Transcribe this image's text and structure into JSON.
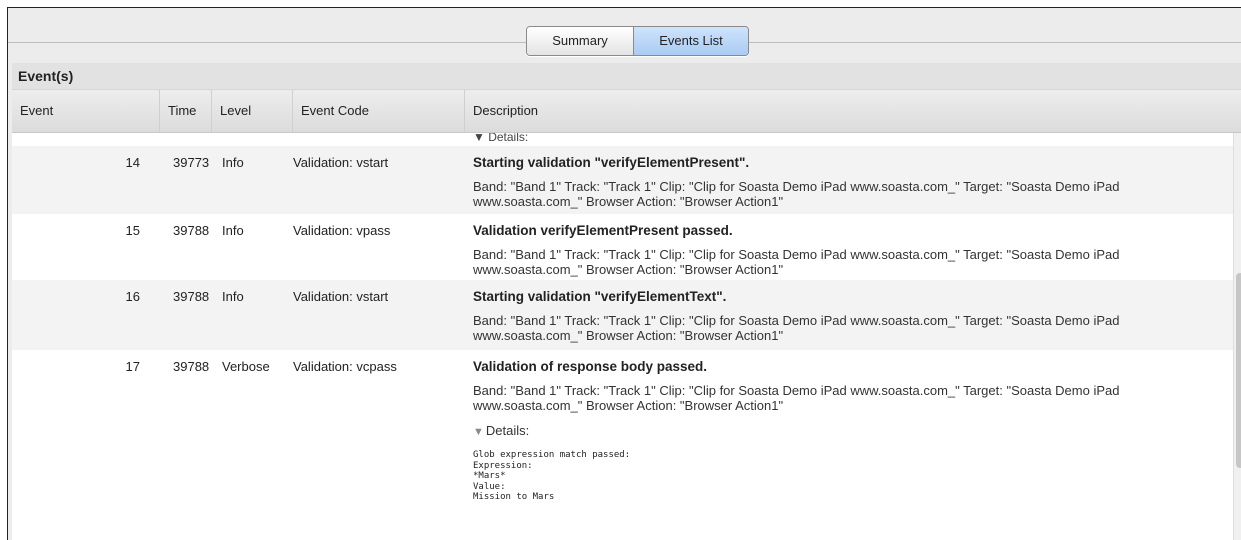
{
  "tabs": {
    "summary": "Summary",
    "events": "Events List"
  },
  "panel": {
    "title": "Event(s)"
  },
  "columns": {
    "event": "Event",
    "time": "Time",
    "level": "Level",
    "code": "Event Code",
    "desc": "Description"
  },
  "cutoff_text": "▼ Details:",
  "rows": [
    {
      "event": "14",
      "time": "39773",
      "level": "Info",
      "code": "Validation: vstart",
      "title": "Starting validation \"verifyElementPresent\".",
      "detail": "Band: \"Band 1\" Track: \"Track 1\" Clip: \"Clip for Soasta Demo iPad www.soasta.com_\" Target: \"Soasta Demo iPad www.soasta.com_\" Browser Action: \"Browser Action1\""
    },
    {
      "event": "15",
      "time": "39788",
      "level": "Info",
      "code": "Validation: vpass",
      "title": "Validation verifyElementPresent passed.",
      "detail": "Band: \"Band 1\" Track: \"Track 1\" Clip: \"Clip for Soasta Demo iPad www.soasta.com_\" Target: \"Soasta Demo iPad www.soasta.com_\" Browser Action: \"Browser Action1\""
    },
    {
      "event": "16",
      "time": "39788",
      "level": "Info",
      "code": "Validation: vstart",
      "title": "Starting validation \"verifyElementText\".",
      "detail": "Band: \"Band 1\" Track: \"Track 1\" Clip: \"Clip for Soasta Demo iPad www.soasta.com_\" Target: \"Soasta Demo iPad www.soasta.com_\" Browser Action: \"Browser Action1\""
    },
    {
      "event": "17",
      "time": "39788",
      "level": "Verbose",
      "code": "Validation: vcpass",
      "title": "Validation of response body passed.",
      "detail": "Band: \"Band 1\" Track: \"Track 1\" Clip: \"Clip for Soasta Demo iPad www.soasta.com_\" Target: \"Soasta Demo iPad www.soasta.com_\" Browser Action: \"Browser Action1\"",
      "details_label": "Details:",
      "details_text": "Glob expression match passed:\nExpression:\n*Mars*\nValue:\nMission to Mars"
    }
  ]
}
